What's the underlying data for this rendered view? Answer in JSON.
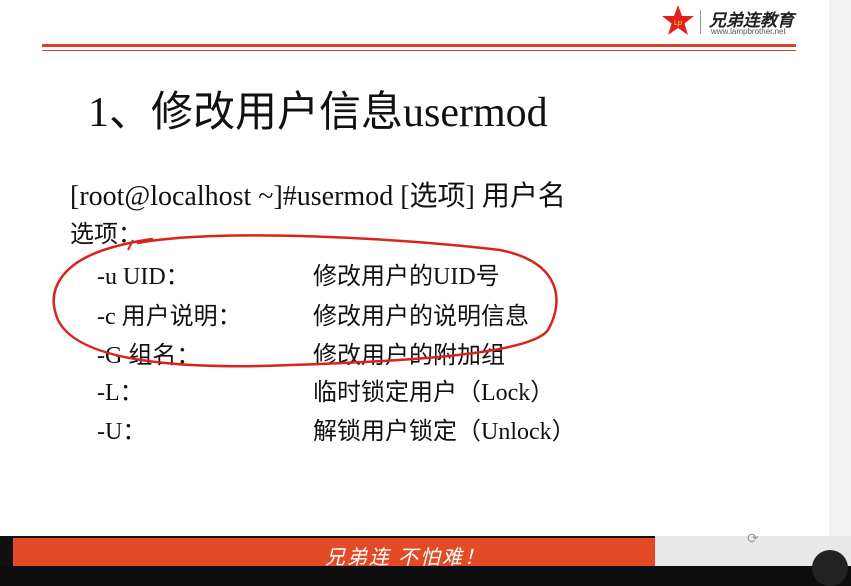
{
  "header": {
    "logo_text": "兄弟连教育",
    "logo_url": "www.lampbrother.net",
    "accent_color": "#d9412b"
  },
  "slide": {
    "title": "1、修改用户信息usermod",
    "command": "[root@localhost ~]#usermod [选项] 用户名",
    "options_label": "选项：",
    "options": [
      {
        "flag": "-u UID：",
        "desc": "修改用户的UID号"
      },
      {
        "flag": "-c 用户说明：",
        "desc": "修改用户的说明信息"
      },
      {
        "flag": "-G 组名：",
        "desc": "修改用户的附加组"
      },
      {
        "flag": "-L：",
        "desc": "临时锁定用户（Lock）"
      },
      {
        "flag": "-U：",
        "desc": "解锁用户锁定（Unlock）"
      }
    ]
  },
  "footer": {
    "slogan": "兄弟连 不怕难！",
    "bar_color": "#e24b26"
  }
}
